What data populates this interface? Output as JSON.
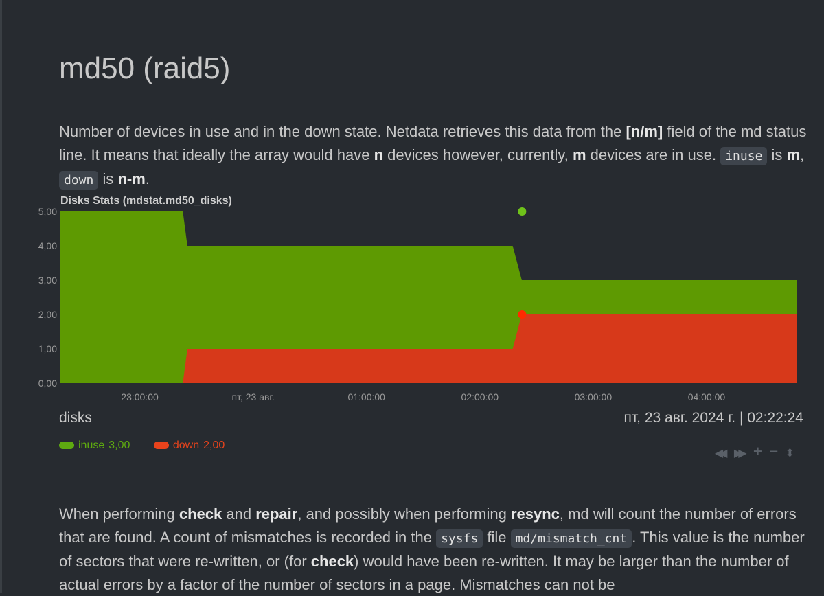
{
  "page": {
    "title": "md50 (raid5)"
  },
  "intro": {
    "t1": "Number of devices in use and in the down state. Netdata retrieves this data from the ",
    "b1": "[n/m]",
    "t2": " field of the md status line. It means that ideally the array would have ",
    "b2": "n",
    "t3": " devices however, currently, ",
    "b3": "m",
    "t4": " devices are in use. ",
    "c1": "inuse",
    "t5": " is ",
    "b4": "m",
    "t6": ", ",
    "c2": "down",
    "t7": " is ",
    "b5": "n-m",
    "t8": "."
  },
  "chart": {
    "heading": "Disks Stats (mdstat.md50_disks)",
    "units": "disks",
    "timestamp": "пт, 23 авг. 2024 г. | 02:22:24"
  },
  "chart_data": {
    "type": "area",
    "title": "Disks Stats (mdstat.md50_disks)",
    "ylabel": "disks",
    "ylim": [
      0,
      5
    ],
    "y_ticks": [
      "5,00",
      "4,00",
      "3,00",
      "2,00",
      "1,00",
      "0,00"
    ],
    "x_range": [
      22.3,
      28.8
    ],
    "x_ticks": [
      {
        "at": 23,
        "label": "23:00:00"
      },
      {
        "at": 24,
        "label": "пт, 23 авг."
      },
      {
        "at": 25,
        "label": "01:00:00"
      },
      {
        "at": 26,
        "label": "02:00:00"
      },
      {
        "at": 27,
        "label": "03:00:00"
      },
      {
        "at": 28,
        "label": "04:00:00"
      }
    ],
    "stacked": true,
    "grid": false,
    "highlight_x": 26.373,
    "series": [
      {
        "name": "down",
        "color": "#d7391a",
        "points": [
          [
            22.3,
            0
          ],
          [
            23.38,
            0
          ],
          [
            23.42,
            1
          ],
          [
            26.29,
            1
          ],
          [
            26.37,
            2
          ],
          [
            28.8,
            2
          ]
        ]
      },
      {
        "name": "inuse",
        "color": "#5e9a02",
        "points": [
          [
            22.3,
            5
          ],
          [
            23.38,
            5
          ],
          [
            23.42,
            4
          ],
          [
            26.29,
            4
          ],
          [
            26.37,
            3
          ],
          [
            28.8,
            3
          ]
        ]
      }
    ]
  },
  "legend": [
    {
      "name": "inuse",
      "value": "3,00",
      "color": "#5eaa10"
    },
    {
      "name": "down",
      "value": "2,00",
      "color": "#e8431c"
    }
  ],
  "toolbox": {
    "left": "◀◀",
    "right": "▶▶",
    "zoom_in": "+",
    "zoom_out": "−",
    "resize": "⬍"
  },
  "para2": {
    "t1": "When performing ",
    "b1": "check",
    "t2": " and ",
    "b2": "repair",
    "t3": ", and possibly when performing ",
    "b3": "resync",
    "t4": ", md will count the number of errors that are found. A count of mismatches is recorded in the ",
    "c1": "sysfs",
    "t5": " file ",
    "c2": "md/mismatch_cnt",
    "t6": ". This value is the number of sectors that were re-written, or (for ",
    "b4": "check",
    "t7": ") would have been re-written. It may be larger than the number of actual errors by a factor of the number of sectors in a page. Mismatches can not be"
  }
}
